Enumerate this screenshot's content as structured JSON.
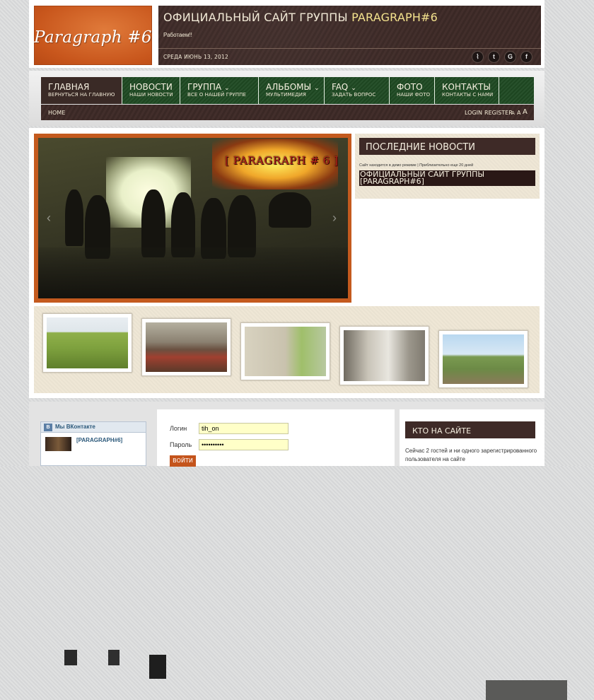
{
  "header": {
    "logo_text": "Paragraph #6",
    "site_title_prefix": "ОФИЦИАЛЬНЫЙ САЙТ ГРУППЫ ",
    "site_title_highlight": "PARAGRAPH#6",
    "tagline": "Работаем!!",
    "date": "СРЕДА ИЮНЬ 13, 2012",
    "social": [
      {
        "icon": "rss-icon",
        "glyph": "⌇"
      },
      {
        "icon": "twitter-icon",
        "glyph": "t"
      },
      {
        "icon": "google-icon",
        "glyph": "G"
      },
      {
        "icon": "facebook-icon",
        "glyph": "f"
      }
    ]
  },
  "nav": {
    "items": [
      {
        "label": "ГЛАВНАЯ",
        "sub": "ВЕРНУТЬСЯ НА ГЛАВНУЮ",
        "has_dropdown": false
      },
      {
        "label": "НОВОСТИ",
        "sub": "НАШИ НОВОСТИ",
        "has_dropdown": false
      },
      {
        "label": "ГРУППА",
        "sub": "ВСЕ О НАШЕЙ ГРУППЕ",
        "has_dropdown": true
      },
      {
        "label": "АЛЬБОМЫ",
        "sub": "МУЛЬТИМЕДИЯ",
        "has_dropdown": true
      },
      {
        "label": "FAQ",
        "sub": "ЗАДАТЬ ВОПРОС",
        "has_dropdown": true
      },
      {
        "label": "ФОТО",
        "sub": "НАШИ ФОТО",
        "has_dropdown": false
      },
      {
        "label": "КОНТАКТЫ",
        "sub": "КОНТАКТЫ С НАМИ",
        "has_dropdown": false
      }
    ],
    "active_index": 0,
    "chevron": "⌄"
  },
  "subbar": {
    "home": "HOME",
    "login": "LOGIN",
    "register": "REGISTER",
    "font_sizes": [
      "A",
      "A",
      "A"
    ]
  },
  "slider": {
    "band_logo": "[ PARAGRAPH # 6 ]",
    "prev": "‹",
    "next": "›"
  },
  "news": {
    "title": "ПОСЛЕДНИЕ НОВОСТИ",
    "info": "Сайт находится в демо режиме | Приблизительно еще 20 дней",
    "item": "ОФИЦИАЛЬНЫЙ САЙТ ГРУППЫ [PARAGRAPH#6]"
  },
  "vk": {
    "badge": "B",
    "label": "Мы ВКонтакте",
    "name": "[PARAGRAPH#6]"
  },
  "login": {
    "login_label": "Логин",
    "password_label": "Пароль",
    "login_value": "tih_on",
    "password_value": "••••••••••",
    "button": "ВОЙТИ"
  },
  "online": {
    "title": "КТО НА САЙТЕ",
    "text": "Сейчас 2 гостей и ни одного зарегистрированного пользователя на сайте"
  }
}
